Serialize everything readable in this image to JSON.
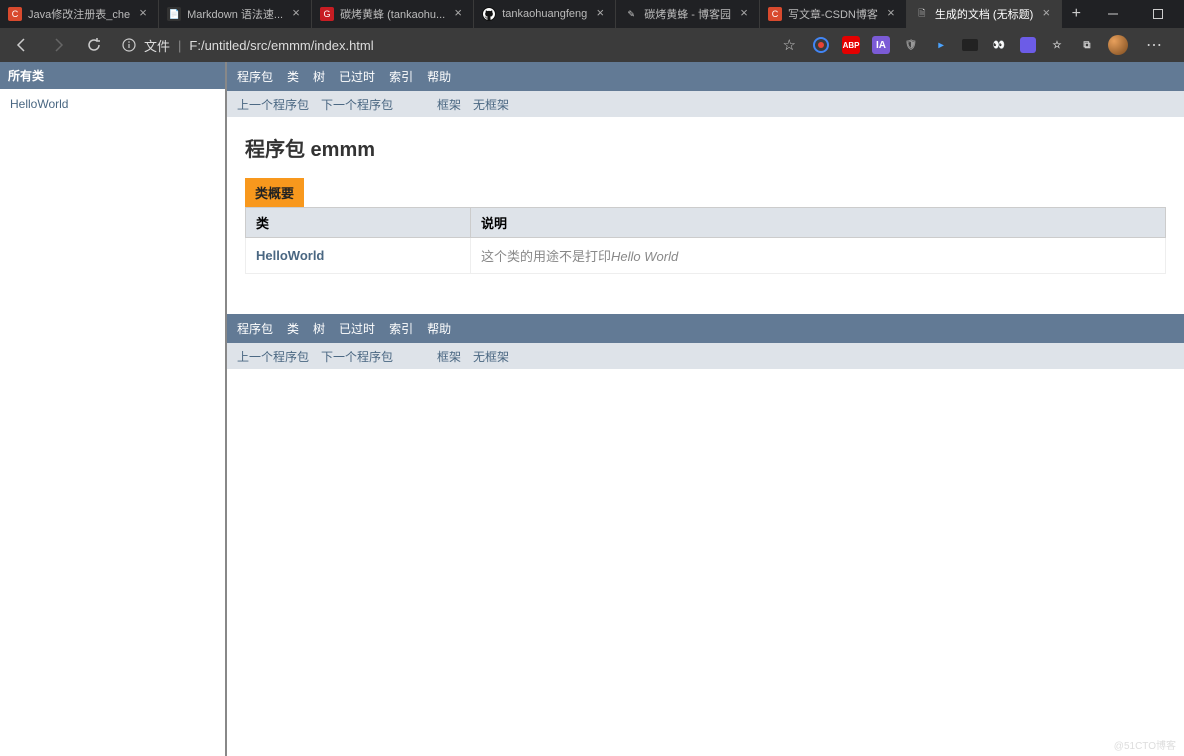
{
  "browser": {
    "tabs": [
      {
        "icon_bg": "#d84a2e",
        "icon_txt": "C",
        "icon_color": "#fff",
        "title": "Java修改注册表_che"
      },
      {
        "icon_bg": "#333",
        "icon_txt": "📄",
        "icon_color": "#fff",
        "title": "Markdown 语法速..."
      },
      {
        "icon_bg": "#c71d23",
        "icon_txt": "G",
        "icon_color": "#fff",
        "title": "碳烤黄蜂 (tankaohu..."
      },
      {
        "icon_bg": "#111",
        "icon_txt": "⌂",
        "icon_color": "#fff",
        "title": "tankaohuangfeng"
      },
      {
        "icon_bg": "#333",
        "icon_txt": "✎",
        "icon_color": "#ccc",
        "title": "碳烤黄蜂 - 博客园"
      },
      {
        "icon_bg": "#d84a2e",
        "icon_txt": "C",
        "icon_color": "#fff",
        "title": "写文章-CSDN博客"
      },
      {
        "icon_bg": "#555",
        "icon_txt": "📄",
        "icon_color": "#fff",
        "title": "生成的文档 (无标题)",
        "active": true
      }
    ],
    "url_label": "文件",
    "url_path": "F:/untitled/src/emmm/index.html"
  },
  "sidebar": {
    "header": "所有类",
    "links": [
      "HelloWorld"
    ]
  },
  "nav": {
    "items": [
      "程序包",
      "类",
      "树",
      "已过时",
      "索引",
      "帮助"
    ],
    "sub_prev": "上一个程序包",
    "sub_next": "下一个程序包",
    "sub_frame": "框架",
    "sub_noframe": "无框架"
  },
  "page": {
    "title": "程序包 emmm",
    "table_caption": "类概要",
    "col_class": "类",
    "col_desc": "说明",
    "rows": [
      {
        "name": "HelloWorld",
        "desc_plain": "这个类的用途不是打印",
        "desc_italic": "Hello World"
      }
    ]
  },
  "watermark": "@51CTO博客"
}
